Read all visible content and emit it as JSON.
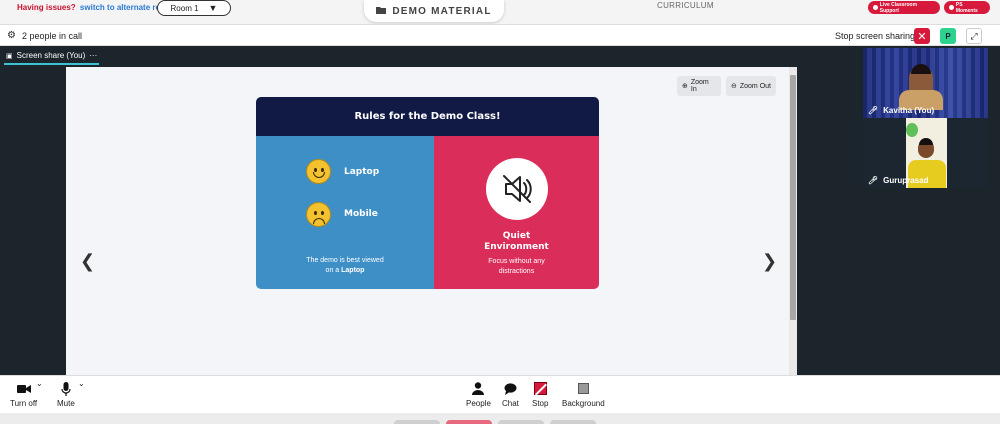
{
  "topbar": {
    "issues_text": "Having issues?",
    "alt_room_link": "switch to alternate room",
    "room_select": "Room 1",
    "demo_material": "DEMO MATERIAL",
    "curriculum": "CURRICULUM",
    "live_support": "Live Classroom Support",
    "ps_moments": "PS Moments"
  },
  "callbar": {
    "people_count": "2 people in call",
    "stop_sharing": "Stop screen sharing",
    "p_badge": "P"
  },
  "stage": {
    "tab_label": "Screen share (You)",
    "tab_more": "···",
    "zoom_in": "Zoom In",
    "zoom_out": "Zoom Out"
  },
  "slide": {
    "title": "Rules for the Demo Class!",
    "item1": "Laptop",
    "item2": "Mobile",
    "note_line1": "The demo is best viewed",
    "note_line2_prefix": "on a ",
    "note_line2_bold": "Laptop",
    "right_title_1": "Quiet",
    "right_title_2": "Environment",
    "right_note_1": "Focus without any",
    "right_note_2": "distractions"
  },
  "participants": [
    {
      "name": "Kavitha (You)"
    },
    {
      "name": "Guruprasad"
    }
  ],
  "toolbar": {
    "turn_off": "Turn off",
    "mute": "Mute",
    "people": "People",
    "chat": "Chat",
    "stop": "Stop",
    "background": "Background"
  },
  "colors": {
    "accent_red": "#d7193c",
    "slide_blue": "#3f8fc7",
    "slide_pink": "#db2d5a",
    "slide_navy": "#111a45",
    "stage_dark": "#1c252c"
  }
}
